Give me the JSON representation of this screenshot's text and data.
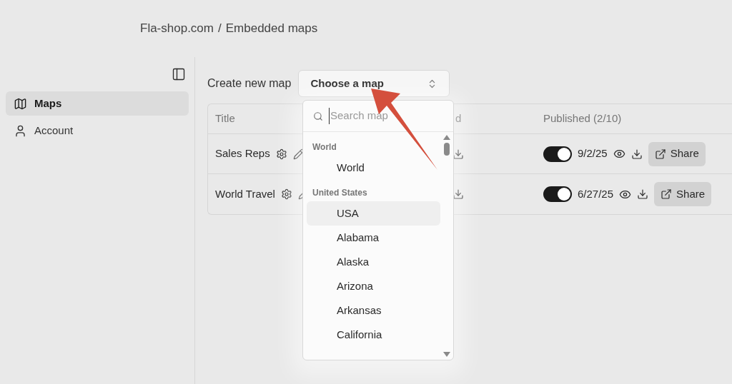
{
  "breadcrumb": {
    "items": [
      "Fla-shop.com",
      "Embedded maps"
    ],
    "separator": "/"
  },
  "sidebar": {
    "items": [
      {
        "label": "Maps",
        "selected": true
      },
      {
        "label": "Account",
        "selected": false
      }
    ]
  },
  "create": {
    "label": "Create new map",
    "select": {
      "value": "Choose a map",
      "expanded": true
    }
  },
  "table": {
    "columns": [
      "Title",
      "d",
      "Published (2/10)"
    ],
    "rows": [
      {
        "title": "Sales Reps",
        "published": {
          "on": true,
          "date": "9/2/25"
        },
        "share": "Share"
      },
      {
        "title": "World Travel",
        "published": {
          "on": true,
          "date": "6/27/25"
        },
        "share": "Share"
      }
    ]
  },
  "dropdown": {
    "search": {
      "placeholder": "Search map"
    },
    "groups": [
      {
        "label": "World",
        "items": [
          {
            "label": "World",
            "selected": false
          }
        ]
      },
      {
        "label": "United States",
        "items": [
          {
            "label": "USA",
            "selected": true
          },
          {
            "label": "Alabama",
            "selected": false
          },
          {
            "label": "Alaska",
            "selected": false
          },
          {
            "label": "Arizona",
            "selected": false
          },
          {
            "label": "Arkansas",
            "selected": false
          },
          {
            "label": "California",
            "selected": false
          }
        ]
      }
    ]
  }
}
